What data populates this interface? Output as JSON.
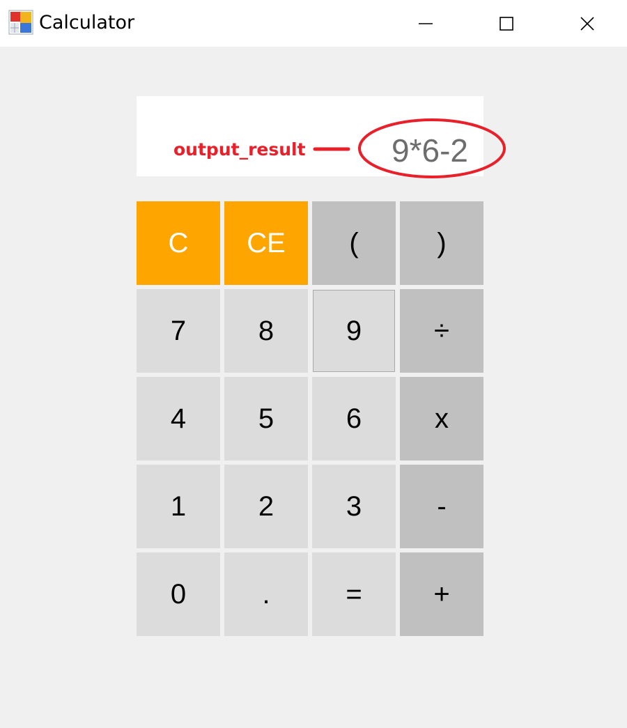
{
  "window": {
    "title": "Calculator",
    "controls": {
      "minimize": "minimize-icon",
      "maximize": "maximize-icon",
      "close": "close-icon"
    }
  },
  "display": {
    "value": "9*6-2"
  },
  "annotation": {
    "label": "output_result",
    "color": "#e8202a"
  },
  "keys": [
    {
      "label": "C",
      "style": "orange",
      "name": "clear"
    },
    {
      "label": "CE",
      "style": "orange",
      "name": "clear-entry"
    },
    {
      "label": "(",
      "style": "op",
      "name": "open-paren"
    },
    {
      "label": ")",
      "style": "op",
      "name": "close-paren"
    },
    {
      "label": "7",
      "style": "num",
      "name": "digit-7"
    },
    {
      "label": "8",
      "style": "num",
      "name": "digit-8"
    },
    {
      "label": "9",
      "style": "focused",
      "name": "digit-9"
    },
    {
      "label": "÷",
      "style": "op",
      "name": "divide"
    },
    {
      "label": "4",
      "style": "num",
      "name": "digit-4"
    },
    {
      "label": "5",
      "style": "num",
      "name": "digit-5"
    },
    {
      "label": "6",
      "style": "num",
      "name": "digit-6"
    },
    {
      "label": "x",
      "style": "op",
      "name": "multiply"
    },
    {
      "label": "1",
      "style": "num",
      "name": "digit-1"
    },
    {
      "label": "2",
      "style": "num",
      "name": "digit-2"
    },
    {
      "label": "3",
      "style": "num",
      "name": "digit-3"
    },
    {
      "label": "-",
      "style": "op",
      "name": "subtract"
    },
    {
      "label": "0",
      "style": "num",
      "name": "digit-0"
    },
    {
      "label": ".",
      "style": "num",
      "name": "decimal"
    },
    {
      "label": "=",
      "style": "num",
      "name": "equals"
    },
    {
      "label": "+",
      "style": "op",
      "name": "add"
    }
  ],
  "colors": {
    "accent": "#ffa500",
    "operator": "#c0c0c0",
    "number": "#dcdcdc",
    "background": "#f0f0f0"
  }
}
